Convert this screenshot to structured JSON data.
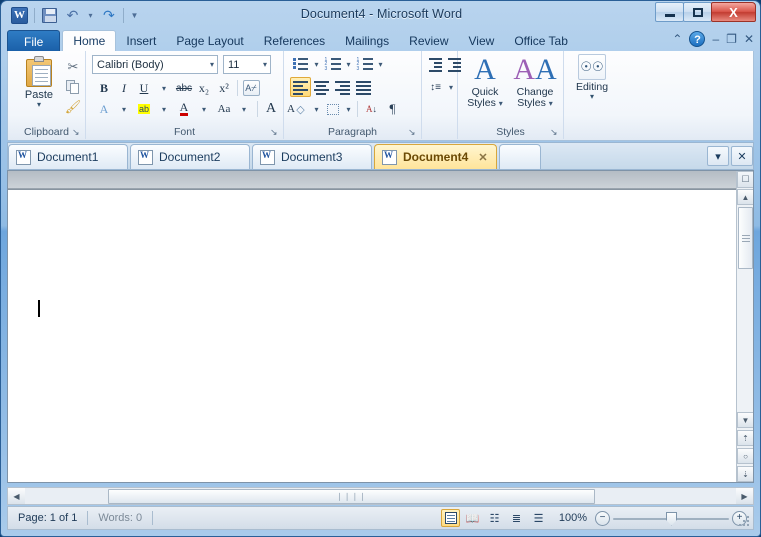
{
  "window": {
    "title": "Document4 - Microsoft Word",
    "minimize_label": "Minimize",
    "maximize_label": "Restore",
    "close_label": "X"
  },
  "quick_access": {
    "logo": "W",
    "items": [
      {
        "name": "save",
        "label": "Save"
      },
      {
        "name": "undo",
        "label": "Undo",
        "glyph": "↶"
      },
      {
        "name": "undo-dropdown",
        "glyph": "▾"
      },
      {
        "name": "redo",
        "label": "Redo",
        "glyph": "↷"
      },
      {
        "name": "customize-qat",
        "glyph": "▾"
      }
    ]
  },
  "ribbon": {
    "tabs": [
      {
        "label": "File",
        "active": false,
        "file": true
      },
      {
        "label": "Home",
        "active": true
      },
      {
        "label": "Insert",
        "active": false
      },
      {
        "label": "Page Layout",
        "active": false
      },
      {
        "label": "References",
        "active": false
      },
      {
        "label": "Mailings",
        "active": false
      },
      {
        "label": "Review",
        "active": false
      },
      {
        "label": "View",
        "active": false
      },
      {
        "label": "Office Tab",
        "active": false
      }
    ],
    "right_controls": {
      "collapse_ribbon": "⌃",
      "help": "?",
      "minimize": "–",
      "restore": "❐",
      "close": "✕"
    },
    "groups": {
      "clipboard": {
        "label": "Clipboard",
        "paste_label": "Paste",
        "paste_dropdown": "▾",
        "cut_label": "Cut",
        "copy_label": "Copy",
        "format_painter_label": "Format Painter",
        "dialog_launcher": "↘"
      },
      "font": {
        "label": "Font",
        "font_name": "Calibri (Body)",
        "font_size": "11",
        "bold": "B",
        "italic": "I",
        "underline": "U",
        "strikethrough": "abc",
        "subscript": "x₂",
        "superscript": "x²",
        "clear_formatting": "A",
        "text_effects": "A",
        "highlight": "ab",
        "font_color": "A",
        "change_case": "Aa",
        "grow_font": "A",
        "shrink_font": "A",
        "dialog_launcher": "↘"
      },
      "paragraph": {
        "label": "Paragraph",
        "bullets": "Bullets",
        "numbering": "Numbering",
        "multilevel": "Multilevel List",
        "decrease_indent": "Decrease Indent",
        "increase_indent": "Increase Indent",
        "line_spacing": "Line and Paragraph Spacing",
        "align_left": "Align Left",
        "align_center": "Center",
        "align_right": "Align Right",
        "justify": "Justify",
        "shading": "Shading",
        "borders": "Borders",
        "sort": "Sort",
        "show_marks": "¶",
        "dialog_launcher": "↘"
      },
      "styles": {
        "label": "Styles",
        "quick_styles_line1": "Quick",
        "quick_styles_line2": "Styles",
        "change_styles_line1": "Change",
        "change_styles_line2": "Styles",
        "dropdown": "▾",
        "dialog_launcher": "↘"
      },
      "editing": {
        "label": "Editing",
        "editing_label": "Editing",
        "dropdown": "▾",
        "find_icon": "༺༻"
      }
    }
  },
  "document_tabs": {
    "tabs": [
      {
        "label": "Document1",
        "active": false,
        "closable": false
      },
      {
        "label": "Document2",
        "active": false,
        "closable": false
      },
      {
        "label": "Document3",
        "active": false,
        "closable": false
      },
      {
        "label": "Document4",
        "active": true,
        "closable": true,
        "close_glyph": "✕"
      }
    ],
    "blank_tab": "",
    "dropdown_glyph": "▾",
    "close_glyph": "✕"
  },
  "document": {
    "content": "",
    "caret_visible": true
  },
  "scrollbars": {
    "view_ruler_label": "View Ruler",
    "up_glyph": "▲",
    "down_glyph": "▼",
    "left_glyph": "◀",
    "right_glyph": "▶",
    "prev_page_glyph": "⤒",
    "browse_object_glyph": "○",
    "next_page_glyph": "⤓",
    "h_thumb_grip": "❘❘❘❘"
  },
  "status_bar": {
    "page": "Page: 1 of 1",
    "words": "Words: 0",
    "zoom": "100%",
    "zoom_out": "−",
    "zoom_in": "+",
    "views": [
      {
        "name": "print-layout",
        "active": true
      },
      {
        "name": "full-screen-reading",
        "active": false
      },
      {
        "name": "web-layout",
        "active": false
      },
      {
        "name": "outline",
        "active": false
      },
      {
        "name": "draft",
        "active": false
      }
    ]
  },
  "colors": {
    "accent_blue": "#1a5fa8",
    "active_tab_yellow": "#ffe49a",
    "close_red": "#c23c31",
    "titlebar_blue": "#8fbbe4"
  }
}
